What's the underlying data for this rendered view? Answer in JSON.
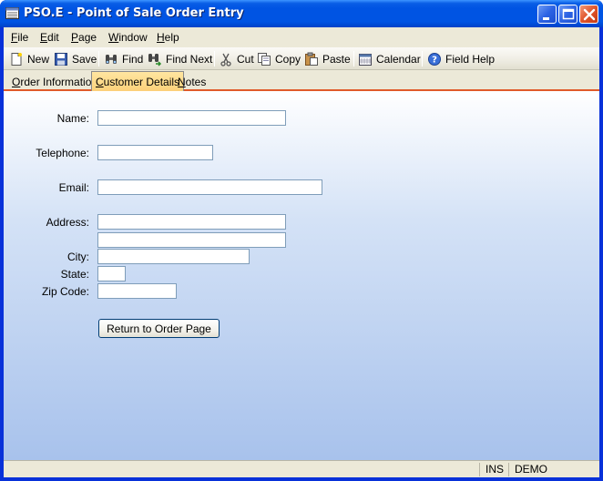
{
  "window": {
    "title": "PSO.E - Point of Sale Order Entry"
  },
  "menu": [
    {
      "name": "File",
      "u": "F",
      "rest": "ile"
    },
    {
      "name": "Edit",
      "u": "E",
      "rest": "dit"
    },
    {
      "name": "Page",
      "u": "P",
      "rest": "age"
    },
    {
      "name": "Window",
      "u": "W",
      "rest": "indow"
    },
    {
      "name": "Help",
      "u": "H",
      "rest": "elp"
    }
  ],
  "toolbar": {
    "new": "New",
    "save": "Save",
    "find": "Find",
    "find_next": "Find Next",
    "cut": "Cut",
    "copy": "Copy",
    "paste": "Paste",
    "calendar": "Calendar",
    "field_help": "Field Help"
  },
  "tabs": {
    "order_information": {
      "u": "O",
      "rest": "rder Information"
    },
    "customer_details": {
      "u": "C",
      "rest": "ustomer Details"
    },
    "notes": {
      "u": "N",
      "rest": "otes"
    }
  },
  "form": {
    "name_label": "Name:",
    "name_value": "",
    "telephone_label": "Telephone:",
    "telephone_value": "",
    "email_label": "Email:",
    "email_value": "",
    "address_label": "Address:",
    "address_line1_value": "",
    "address_line2_value": "",
    "city_label": "City:",
    "city_value": "",
    "state_label": "State:",
    "state_value": "",
    "zip_label": "Zip Code:",
    "zip_value": "",
    "return_button": "Return to Order Page"
  },
  "status": {
    "mode": "INS",
    "account": "DEMO"
  },
  "colors": {
    "titlebar": "#0054e3",
    "active_tab": "#fcd07a",
    "tab_underline": "#e05a2a",
    "form_gradient_top": "#ffffff",
    "form_gradient_bottom": "#a8c2ec"
  }
}
